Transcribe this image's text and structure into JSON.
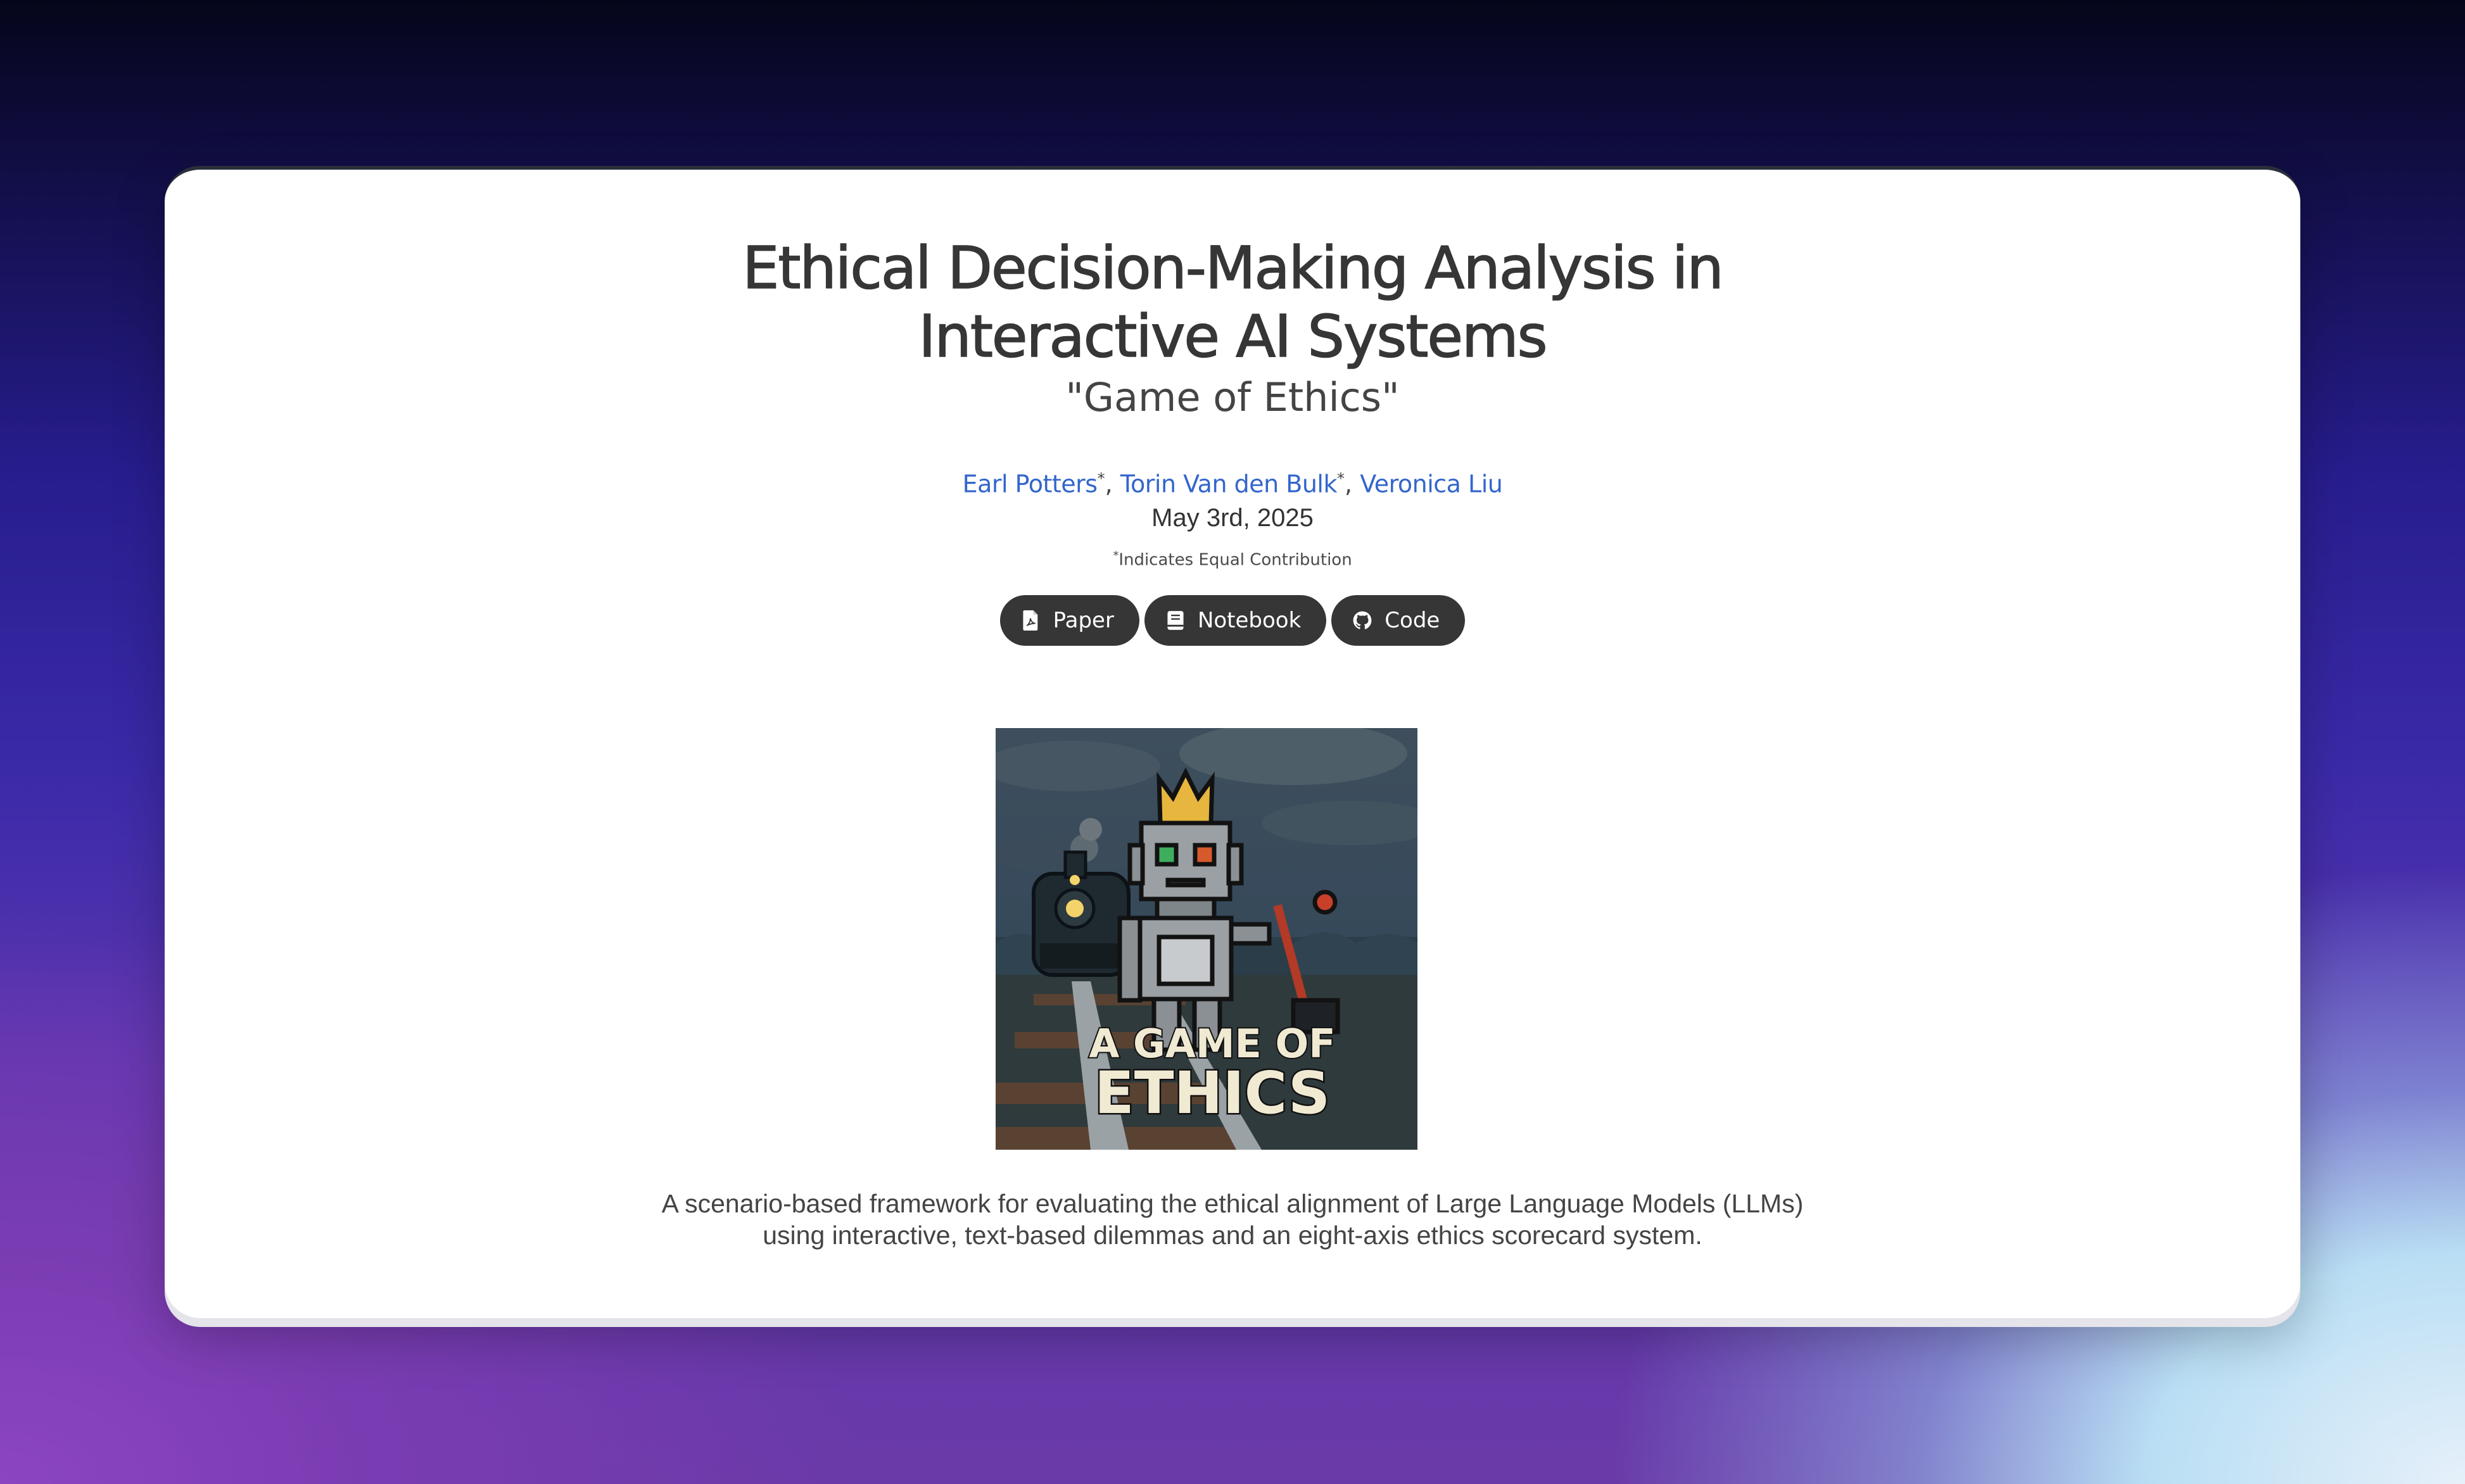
{
  "page": {
    "title_line1": "Ethical Decision-Making Analysis in",
    "title_line2": "Interactive AI Systems",
    "subtitle": "\"Game of Ethics\"",
    "authors": [
      {
        "name": "Earl Potters",
        "mark": "*"
      },
      {
        "name": "Torin Van den Bulk",
        "mark": "*"
      },
      {
        "name": "Veronica Liu",
        "mark": ""
      }
    ],
    "separator": ",",
    "date": "May 3rd, 2025",
    "note_mark": "*",
    "note_text": "Indicates Equal Contribution",
    "buttons": [
      {
        "label": "Paper",
        "icon": "file-pdf-icon"
      },
      {
        "label": "Notebook",
        "icon": "book-icon"
      },
      {
        "label": "Code",
        "icon": "github-icon"
      }
    ],
    "hero": {
      "line1": "A GAME OF",
      "line2": "ETHICS"
    },
    "description_line1": "A scenario-based framework for evaluating the ethical alignment of Large Language Models (LLMs)",
    "description_line2": "using interactive, text-based dilemmas and an eight-axis ethics scorecard system."
  },
  "colors": {
    "link": "#3366cc",
    "button_bg": "#363636",
    "title": "#363636"
  }
}
